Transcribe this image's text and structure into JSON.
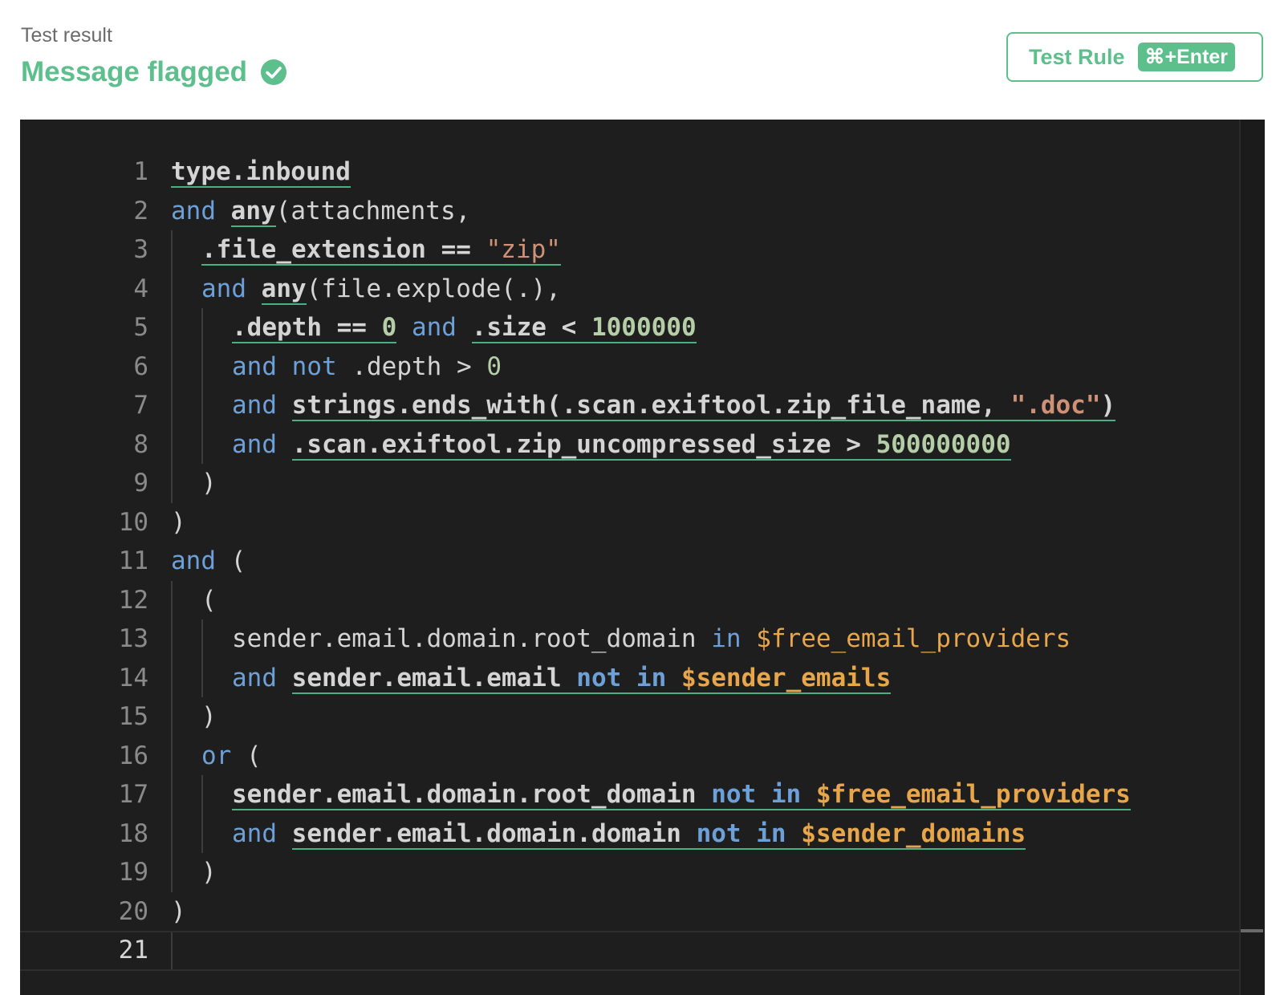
{
  "header": {
    "label": "Test result",
    "status": "Message flagged",
    "status_icon": "check-circle-icon",
    "accent_color": "#5dbf8c"
  },
  "test_button": {
    "label": "Test Rule",
    "shortcut": "⌘+Enter"
  },
  "editor": {
    "current_line": 21,
    "lines": [
      {
        "n": "1",
        "indent": 0,
        "tokens": [
          {
            "t": "type.inbound",
            "k": "plain",
            "b": true,
            "u": true
          }
        ]
      },
      {
        "n": "2",
        "indent": 0,
        "tokens": [
          {
            "t": "and",
            "k": "kw"
          },
          {
            "t": " "
          },
          {
            "t": "any",
            "k": "plain",
            "b": true,
            "u": true
          },
          {
            "t": "(attachments,"
          }
        ]
      },
      {
        "n": "3",
        "indent": 1,
        "tokens": [
          {
            "t": ".file_extension == ",
            "k": "plain",
            "b": true,
            "u": true
          },
          {
            "t": "\"zip\"",
            "k": "str",
            "u": true
          }
        ]
      },
      {
        "n": "4",
        "indent": 1,
        "tokens": [
          {
            "t": "and",
            "k": "kw"
          },
          {
            "t": " "
          },
          {
            "t": "any",
            "k": "plain",
            "b": true,
            "u": true
          },
          {
            "t": "(file.explode(.),"
          }
        ]
      },
      {
        "n": "5",
        "indent": 2,
        "tokens": [
          {
            "t": ".depth == ",
            "k": "plain",
            "b": true,
            "u": true
          },
          {
            "t": "0",
            "k": "num",
            "b": true,
            "u": true
          },
          {
            "t": " "
          },
          {
            "t": "and",
            "k": "kw"
          },
          {
            "t": " "
          },
          {
            "t": ".size < ",
            "k": "plain",
            "b": true,
            "u": true
          },
          {
            "t": "1000000",
            "k": "num",
            "b": true,
            "u": true
          }
        ]
      },
      {
        "n": "6",
        "indent": 2,
        "tokens": [
          {
            "t": "and",
            "k": "kw"
          },
          {
            "t": " "
          },
          {
            "t": "not",
            "k": "kw"
          },
          {
            "t": " .depth > "
          },
          {
            "t": "0",
            "k": "num"
          }
        ]
      },
      {
        "n": "7",
        "indent": 2,
        "tokens": [
          {
            "t": "and",
            "k": "kw"
          },
          {
            "t": " "
          },
          {
            "t": "strings.ends_with(.scan.exiftool.zip_file_name, ",
            "k": "plain",
            "b": true,
            "u": true
          },
          {
            "t": "\".doc\"",
            "k": "str",
            "b": true,
            "u": true
          },
          {
            "t": ")",
            "k": "plain",
            "b": true,
            "u": true
          }
        ]
      },
      {
        "n": "8",
        "indent": 2,
        "tokens": [
          {
            "t": "and",
            "k": "kw"
          },
          {
            "t": " "
          },
          {
            "t": ".scan.exiftool.zip_uncompressed_size > ",
            "k": "plain",
            "b": true,
            "u": true
          },
          {
            "t": "500000000",
            "k": "num",
            "b": true,
            "u": true
          }
        ]
      },
      {
        "n": "9",
        "indent": 1,
        "tokens": [
          {
            "t": ")"
          }
        ]
      },
      {
        "n": "10",
        "indent": 0,
        "tokens": [
          {
            "t": ")"
          }
        ]
      },
      {
        "n": "11",
        "indent": 0,
        "tokens": [
          {
            "t": "and",
            "k": "kw"
          },
          {
            "t": " ("
          }
        ]
      },
      {
        "n": "12",
        "indent": 1,
        "tokens": [
          {
            "t": "("
          }
        ]
      },
      {
        "n": "13",
        "indent": 2,
        "tokens": [
          {
            "t": "sender.email.domain.root_domain "
          },
          {
            "t": "in",
            "k": "kw"
          },
          {
            "t": " "
          },
          {
            "t": "$free_email_providers",
            "k": "var"
          }
        ]
      },
      {
        "n": "14",
        "indent": 2,
        "tokens": [
          {
            "t": "and",
            "k": "kw"
          },
          {
            "t": " "
          },
          {
            "t": "sender.email.email ",
            "k": "plain",
            "b": true,
            "u": true
          },
          {
            "t": "not in ",
            "k": "kw",
            "b": true,
            "u": true
          },
          {
            "t": "$sender_emails",
            "k": "var",
            "b": true,
            "u": true
          }
        ]
      },
      {
        "n": "15",
        "indent": 1,
        "tokens": [
          {
            "t": ")"
          }
        ]
      },
      {
        "n": "16",
        "indent": 1,
        "tokens": [
          {
            "t": "or",
            "k": "kw"
          },
          {
            "t": " ("
          }
        ]
      },
      {
        "n": "17",
        "indent": 2,
        "tokens": [
          {
            "t": "sender.email.domain.root_domain ",
            "k": "plain",
            "b": true,
            "u": true
          },
          {
            "t": "not in ",
            "k": "kw",
            "b": true,
            "u": true
          },
          {
            "t": "$free_email_providers",
            "k": "var",
            "b": true,
            "u": true
          }
        ]
      },
      {
        "n": "18",
        "indent": 2,
        "tokens": [
          {
            "t": "and",
            "k": "kw"
          },
          {
            "t": " "
          },
          {
            "t": "sender.email.domain.domain ",
            "k": "plain",
            "b": true,
            "u": true
          },
          {
            "t": "not in ",
            "k": "kw",
            "b": true,
            "u": true
          },
          {
            "t": "$sender_domains",
            "k": "var",
            "b": true,
            "u": true
          }
        ]
      },
      {
        "n": "19",
        "indent": 1,
        "tokens": [
          {
            "t": ")"
          }
        ]
      },
      {
        "n": "20",
        "indent": 0,
        "tokens": [
          {
            "t": ")"
          }
        ]
      },
      {
        "n": "21",
        "indent": 0,
        "tokens": []
      }
    ]
  }
}
